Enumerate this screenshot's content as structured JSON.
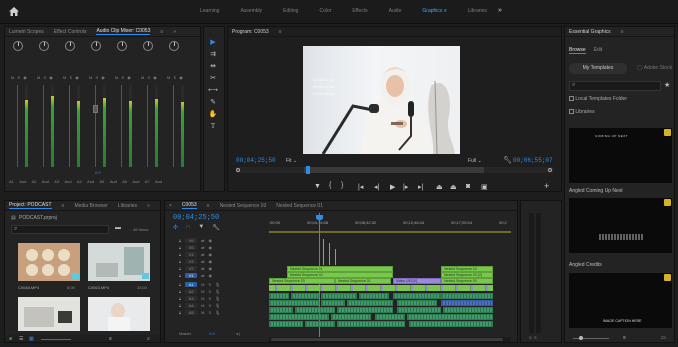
{
  "workspaces": {
    "items": [
      "Learning",
      "Assembly",
      "Editing",
      "Color",
      "Effects",
      "Audio",
      "Graphics",
      "Libraries"
    ],
    "active_index": 6,
    "overflow_symbol": "»"
  },
  "left_panel": {
    "tabs": [
      "Lumetri Scopes",
      "Effect Controls",
      "Audio Clip Mixer: C0053"
    ],
    "active_tab": "Audio Clip Mixer: C0053",
    "menu_symbol": "≡",
    "overflow_symbol": "»",
    "channels": [
      "A1",
      "Aud",
      "A2",
      "Aud",
      "A3",
      "Aud",
      "A4",
      "Aud",
      "A5",
      "Aud",
      "A6",
      "Aud",
      "A7",
      "Aud"
    ],
    "msr_label": "M S ◉",
    "fader_value": "0.0",
    "accent": "#2d8ceb"
  },
  "program_monitor": {
    "title": "Program: C0053",
    "menu_symbol": "≡",
    "timecode_in": "00;04;25;50",
    "fit_label": "Fit",
    "quality_label": "Full",
    "timecode_out": "00;06;55;07",
    "overlay_lines": [
      "00;08;12;44",
      "00;08;13;45",
      "00;08;16;05"
    ]
  },
  "project_panel": {
    "tabs": [
      "Project: PODCAST",
      "Media Browser",
      "Libraries"
    ],
    "menu_symbol": "≡",
    "overflow_symbol": "»",
    "breadcrumb": "PODCAST.prproj",
    "items_count": "46 Items",
    "clips": [
      {
        "name": "C0046.MP4",
        "duration": "8;05"
      },
      {
        "name": "C0063.MP4",
        "duration": "33;00"
      }
    ]
  },
  "timeline": {
    "tabs": [
      "C0053",
      "Nested Sequence 03",
      "Nested Sequence 01"
    ],
    "close_symbol": "×",
    "menu_symbol": "≡",
    "timecode": "00;04;25;50",
    "ruler": [
      ":00;00",
      "00;04;16;08",
      "00;08;32;32",
      "00;12;48;44",
      "00;17;05;04",
      "00;2"
    ],
    "video_tracks": [
      "V6",
      "V5",
      "V4",
      "V3",
      "V2",
      "V1"
    ],
    "audio_tracks": [
      "A1",
      "A2",
      "A3",
      "A4",
      "A5"
    ],
    "master_label": "Master",
    "master_value": "0.0",
    "clips_v": [
      {
        "label": "Nested Sequence 01"
      },
      {
        "label": "Nested Sequence 02"
      },
      {
        "label": "Nested Sequence 03"
      },
      {
        "label": "Nested Sequence 03"
      },
      {
        "label": "Nested Sequence 03 [V]"
      },
      {
        "label": "Nested Sequence 01"
      },
      {
        "label": "Nested Sequence 03"
      },
      {
        "label": "Video 100 [V]"
      }
    ]
  },
  "essential_graphics": {
    "title": "Essential Graphics",
    "menu_symbol": "≡",
    "tabs": [
      "Browse",
      "Edit"
    ],
    "active_tab": "Browse",
    "my_templates": "My Templates",
    "adobe_stock": "Adobe Stock",
    "local_templates": "Local Templates Folder",
    "libraries": "Libraries",
    "sections": [
      "Angled Coming Up Next",
      "Angled Credits"
    ],
    "thumb1_text": "COMING UP NEXT",
    "thumb3_text": "IMAGE CAPTION HERE",
    "badge_color": "#d6b324"
  }
}
